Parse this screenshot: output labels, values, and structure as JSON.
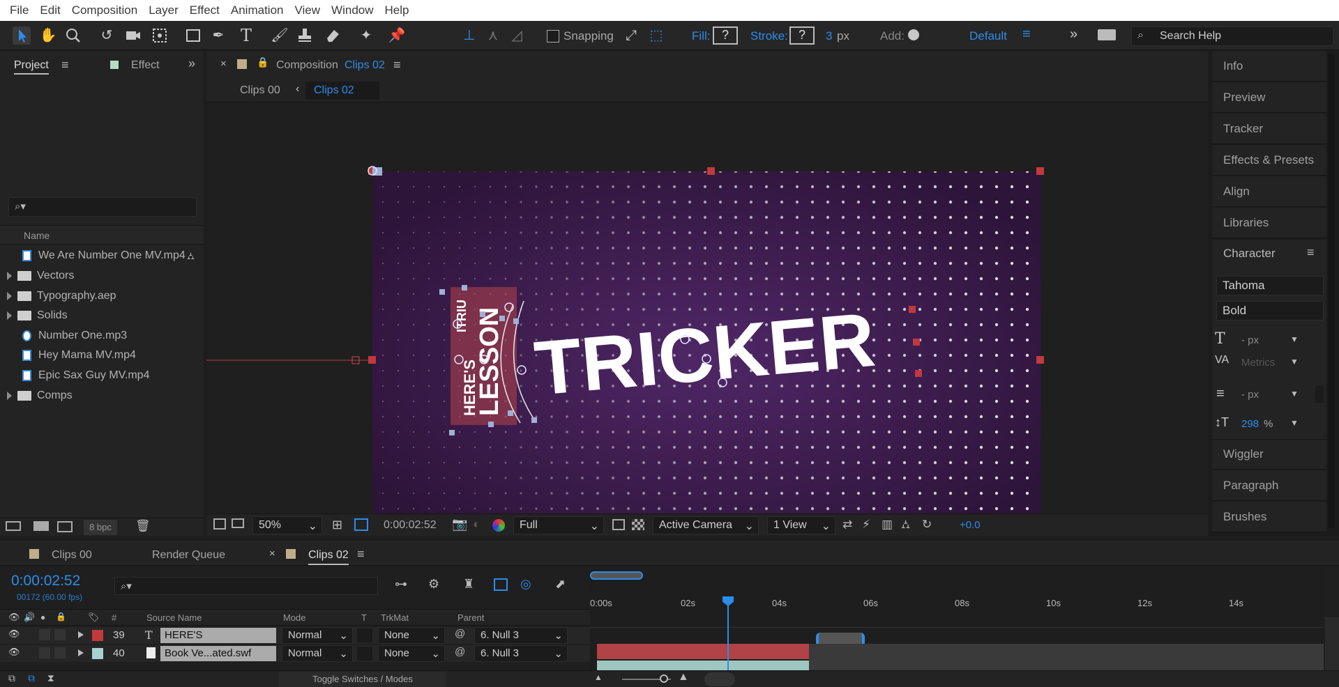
{
  "menubar": {
    "items": [
      "File",
      "Edit",
      "Composition",
      "Layer",
      "Effect",
      "Animation",
      "View",
      "Window",
      "Help"
    ]
  },
  "toolbar": {
    "snapping": "Snapping",
    "fill": "Fill:",
    "stroke": "Stroke:",
    "stroke_width": "3",
    "stroke_unit": "px",
    "add": "Add:",
    "workspace": "Default",
    "search_placeholder": "Search Help",
    "fill_q": "?",
    "stroke_q": "?"
  },
  "project": {
    "tab_project": "Project",
    "tab_effect": "Effect",
    "column_name": "Name",
    "bpc": "8 bpc",
    "items": [
      {
        "label": "We Are Number One MV.mp4",
        "type": "file"
      },
      {
        "label": "Vectors",
        "type": "folder"
      },
      {
        "label": "Typography.aep",
        "type": "folder"
      },
      {
        "label": "Solids",
        "type": "folder"
      },
      {
        "label": "Number One.mp3",
        "type": "audio"
      },
      {
        "label": "Hey Mama MV.mp4",
        "type": "file"
      },
      {
        "label": "Epic Sax Guy MV.mp4",
        "type": "file"
      },
      {
        "label": "Comps",
        "type": "folder"
      }
    ]
  },
  "composition": {
    "tab_label": "Composition",
    "comp_name": "Clips 02",
    "breadcrumb": [
      "Clips 00",
      "Clips 02"
    ],
    "canvas_main_text": "TRICKER",
    "canvas_side_lines": [
      "HERE'S",
      "LESSON",
      "ITRIU"
    ],
    "zoom": "50%",
    "timecode": "0:00:02:52",
    "resolution": "Full",
    "camera": "Active Camera",
    "views": "1 View",
    "exposure": "+0.0"
  },
  "right_panel": {
    "items": [
      "Info",
      "Preview",
      "Tracker",
      "Effects & Presets",
      "Align",
      "Libraries"
    ],
    "character": "Character",
    "font": "Tahoma",
    "style": "Bold",
    "size_unit": "- px",
    "kerning": "Metrics",
    "leading": "- px",
    "vscale": "298",
    "vscale_unit": "%",
    "below": [
      "Wiggler",
      "Paragraph",
      "Brushes"
    ]
  },
  "timeline": {
    "tabs": [
      "Clips 00",
      "Render Queue",
      "Clips 02"
    ],
    "current_time": "0:00:02:52",
    "frames": "00172 (60.00 fps)",
    "columns": {
      "num": "#",
      "source": "Source Name",
      "mode": "Mode",
      "t": "T",
      "trkmat": "TrkMat",
      "parent": "Parent"
    },
    "ruler": [
      "0:00s",
      "02s",
      "04s",
      "06s",
      "08s",
      "10s",
      "12s",
      "14s"
    ],
    "layers": [
      {
        "num": "39",
        "name": "HERE'S",
        "mode": "Normal",
        "trkmat": "None",
        "parent": "6. Null 3",
        "color": "#c13b3b"
      },
      {
        "num": "40",
        "name": "Book Ve...ated.swf",
        "mode": "Normal",
        "trkmat": "None",
        "parent": "6. Null 3",
        "color": "#a6d1cc"
      }
    ],
    "toggle": "Toggle Switches / Modes"
  },
  "colors": {
    "accent": "#2d8ceb",
    "canvas_bg": "#3d1c4e",
    "layer_red": "#c13b3b",
    "layer_teal": "#a6d1cc"
  }
}
